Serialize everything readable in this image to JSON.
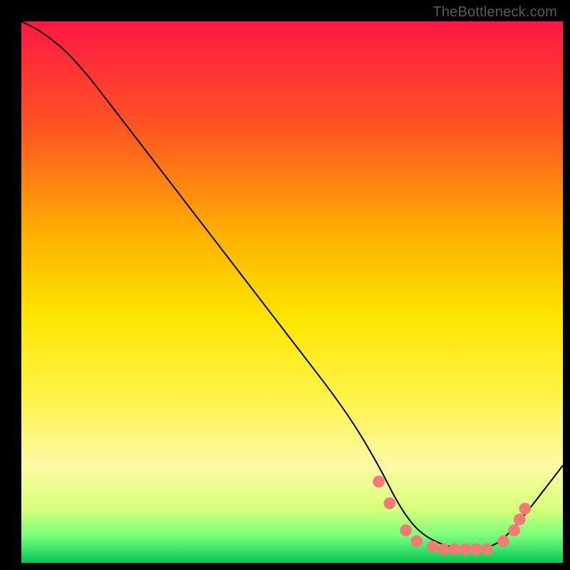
{
  "watermark": "TheBottleneck.com",
  "chart_data": {
    "type": "line",
    "title": "",
    "xlabel": "",
    "ylabel": "",
    "xlim": [
      0,
      100
    ],
    "ylim": [
      0,
      100
    ],
    "gradient_stops": [
      {
        "offset": 0,
        "color": "#ff1744"
      },
      {
        "offset": 20,
        "color": "#ff5622"
      },
      {
        "offset": 40,
        "color": "#ffb300"
      },
      {
        "offset": 55,
        "color": "#ffe600"
      },
      {
        "offset": 70,
        "color": "#fff44d"
      },
      {
        "offset": 82,
        "color": "#fff9a6"
      },
      {
        "offset": 90,
        "color": "#d8ff7a"
      },
      {
        "offset": 95,
        "color": "#7aff7a"
      },
      {
        "offset": 100,
        "color": "#00c853"
      }
    ],
    "series": [
      {
        "name": "curve",
        "color": "#000000",
        "x": [
          0,
          4,
          10,
          20,
          30,
          40,
          50,
          60,
          66,
          70,
          74,
          80,
          86,
          90,
          100
        ],
        "y": [
          100,
          98,
          93,
          80,
          67,
          54,
          41,
          28,
          18,
          10,
          5,
          2.5,
          2.5,
          5,
          18
        ]
      }
    ],
    "markers": {
      "name": "dots",
      "color": "#f47a76",
      "radius": 8,
      "points": [
        {
          "x": 66,
          "y": 15
        },
        {
          "x": 68,
          "y": 11
        },
        {
          "x": 71,
          "y": 6
        },
        {
          "x": 73,
          "y": 4
        },
        {
          "x": 76,
          "y": 3
        },
        {
          "x": 78,
          "y": 2.5
        },
        {
          "x": 80,
          "y": 2.5
        },
        {
          "x": 82,
          "y": 2.5
        },
        {
          "x": 84,
          "y": 2.5
        },
        {
          "x": 86,
          "y": 2.5
        },
        {
          "x": 89,
          "y": 4
        },
        {
          "x": 91,
          "y": 6
        },
        {
          "x": 92,
          "y": 8
        },
        {
          "x": 93,
          "y": 10
        }
      ]
    }
  }
}
